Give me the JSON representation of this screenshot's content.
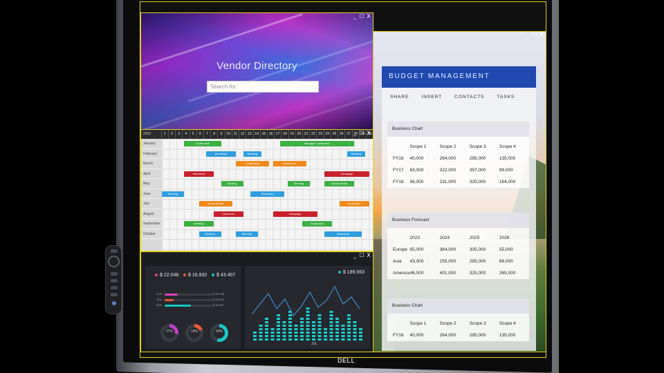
{
  "brand": {
    "logo": "DELL"
  },
  "vendor": {
    "title": "Vendor Directory",
    "search_placeholder": "Search for:"
  },
  "calendar": {
    "year": "2023",
    "days": [
      "1",
      "2",
      "3",
      "4",
      "5",
      "6",
      "7",
      "8",
      "9",
      "10",
      "11",
      "12",
      "13",
      "14",
      "15",
      "16",
      "17",
      "18",
      "19",
      "20",
      "21",
      "22",
      "23",
      "24",
      "25",
      "26",
      "27",
      "28",
      "29",
      "30"
    ],
    "months": [
      "January",
      "February",
      "March",
      "April",
      "May",
      "June",
      "July",
      "August",
      "September",
      "October"
    ],
    "events": [
      {
        "label": "Conference",
        "row": 0,
        "start": 3,
        "len": 5,
        "color": "#3cb043"
      },
      {
        "label": "Manager Conference",
        "row": 0,
        "start": 16,
        "len": 10,
        "color": "#3cb043"
      },
      {
        "label": "Workshop",
        "row": 1,
        "start": 6,
        "len": 4,
        "color": "#2e9ee0"
      },
      {
        "label": "Meeting",
        "row": 1,
        "start": 11,
        "len": 2.5,
        "color": "#2e9ee0"
      },
      {
        "label": "Meeting",
        "row": 1,
        "start": 25,
        "len": 2.5,
        "color": "#2e9ee0"
      },
      {
        "label": "Conference",
        "row": 2,
        "start": 10,
        "len": 4.5,
        "color": "#f08a1c"
      },
      {
        "label": "Brainstorm",
        "row": 2,
        "start": 15,
        "len": 4.5,
        "color": "#f08a1c"
      },
      {
        "label": "Interviews",
        "row": 3,
        "start": 3,
        "len": 4,
        "color": "#c8202c"
      },
      {
        "label": "Campaign",
        "row": 3,
        "start": 22,
        "len": 6,
        "color": "#c8202c"
      },
      {
        "label": "Meeting",
        "row": 4,
        "start": 8,
        "len": 3,
        "color": "#3cb043"
      },
      {
        "label": "Meeting",
        "row": 4,
        "start": 17,
        "len": 3,
        "color": "#3cb043"
      },
      {
        "label": "Social Media",
        "row": 4,
        "start": 22,
        "len": 4,
        "color": "#3cb043"
      },
      {
        "label": "Meeting",
        "row": 5,
        "start": 0,
        "len": 3,
        "color": "#2e9ee0"
      },
      {
        "label": "Workshop",
        "row": 5,
        "start": 12,
        "len": 4.5,
        "color": "#2e9ee0"
      },
      {
        "label": "Social Media",
        "row": 6,
        "start": 5,
        "len": 4.5,
        "color": "#f08a1c"
      },
      {
        "label": "Evaluation",
        "row": 6,
        "start": 24,
        "len": 4,
        "color": "#f08a1c"
      },
      {
        "label": "Interviews",
        "row": 7,
        "start": 7,
        "len": 4,
        "color": "#c8202c"
      },
      {
        "label": "Campaign",
        "row": 7,
        "start": 15,
        "len": 6,
        "color": "#c8202c"
      },
      {
        "label": "Meeting",
        "row": 8,
        "start": 3,
        "len": 4,
        "color": "#3cb043"
      },
      {
        "label": "Evaluation",
        "row": 8,
        "start": 19,
        "len": 4,
        "color": "#3cb043"
      },
      {
        "label": "Meeting",
        "row": 9,
        "start": 5,
        "len": 3,
        "color": "#2e9ee0"
      },
      {
        "label": "Meeting",
        "row": 9,
        "start": 10,
        "len": 3,
        "color": "#2e9ee0"
      },
      {
        "label": "Workshop",
        "row": 9,
        "start": 22,
        "len": 5,
        "color": "#2e9ee0"
      }
    ]
  },
  "dashboard": {
    "stats": [
      {
        "value": "$ 22.048",
        "color": "#e040a0"
      },
      {
        "value": "$ 16.932",
        "color": "#e85a3a"
      },
      {
        "value": "$ 43.407",
        "color": "#18c8c8"
      }
    ],
    "bars": [
      {
        "label": "27%",
        "value": "$ 22.048",
        "fraction": 0.27,
        "color": "#e040c0"
      },
      {
        "label": "19%",
        "value": "$ 16.932",
        "fraction": 0.19,
        "color": "#e85a3a"
      },
      {
        "label": "54%",
        "value": "$ 43.407",
        "fraction": 0.54,
        "color": "#18c8c8"
      }
    ],
    "donuts": [
      {
        "pct": "27%",
        "fraction": 0.27,
        "color": "#c040c8"
      },
      {
        "pct": "19%",
        "fraction": 0.19,
        "color": "#e85a3a"
      },
      {
        "pct": "54%",
        "fraction": 0.54,
        "color": "#18c8c8"
      }
    ],
    "total": "$ 189.563",
    "total_color": "#18c8c8",
    "chart_tag": "JUL"
  },
  "budget": {
    "title": "BUDGET MANAGEMENT",
    "menu": [
      "SHARE",
      "INSERT",
      "CONTACTS",
      "TASKS"
    ],
    "tables": [
      {
        "title": "Business Chart",
        "columns": [
          "",
          "Scope 1",
          "Scope 2",
          "Scope 3",
          "Scope 4"
        ],
        "rows": [
          [
            "FY16",
            "40,000",
            "264,000",
            "285,000",
            "135,000"
          ],
          [
            "FY17",
            "83,000",
            "322,000",
            "397,000",
            "89,000"
          ],
          [
            "FY18",
            "96,000",
            "231,000",
            "325,000",
            "164,000"
          ]
        ]
      },
      {
        "title": "Business Forecast",
        "columns": [
          "",
          "2023",
          "2024",
          "2025",
          "2026"
        ],
        "rows": [
          [
            "Europe",
            "65,000",
            "364,000",
            "305,000",
            "55,000"
          ],
          [
            "Asia",
            "43,000",
            "255,000",
            "285,000",
            "66,000"
          ],
          [
            "America",
            "46,000",
            "401,000",
            "325,000",
            "265,000"
          ]
        ]
      },
      {
        "title": "Business Chart",
        "columns": [
          "",
          "Scope 1",
          "Scope 2",
          "Scope 3",
          "Scope 4"
        ],
        "rows": [
          [
            "FY16",
            "40,000",
            "264,000",
            "285,000",
            "135,000"
          ]
        ]
      }
    ]
  },
  "window_controls": [
    "_",
    "☐",
    "X"
  ]
}
